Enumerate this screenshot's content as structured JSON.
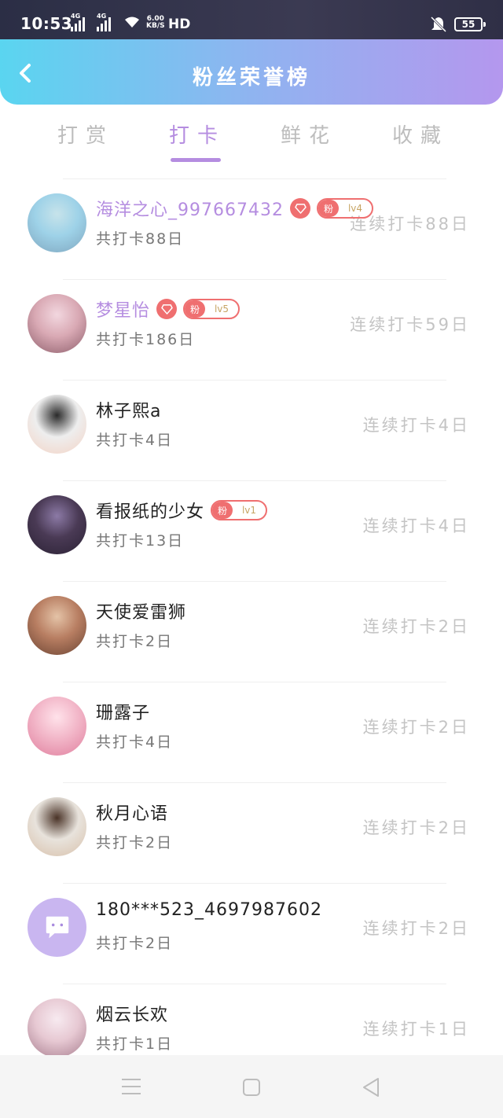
{
  "status_bar": {
    "time": "10:53",
    "network1": "4G",
    "network2": "4G",
    "speed_value": "6.00",
    "speed_unit": "KB/S",
    "hd": "HD",
    "battery": "55"
  },
  "header": {
    "title": "粉丝荣誉榜",
    "back_icon": "chevron-left-icon"
  },
  "tabs": [
    {
      "label": "打赏",
      "active": false
    },
    {
      "label": "打卡",
      "active": true
    },
    {
      "label": "鲜花",
      "active": false
    },
    {
      "label": "收藏",
      "active": false
    }
  ],
  "list": [
    {
      "name": "海洋之心_997667432",
      "vip": true,
      "gem": true,
      "fan_label": "粉",
      "level": "lv4",
      "total": "共打卡88日",
      "streak": "连续打卡88日",
      "avatar_colors": [
        "#9ed2e8",
        "#c7e3ea",
        "#7fa6bf"
      ]
    },
    {
      "name": "梦星怡",
      "vip": true,
      "gem": true,
      "fan_label": "粉",
      "level": "lv5",
      "total": "共打卡186日",
      "streak": "连续打卡59日",
      "avatar_colors": [
        "#d9a9b4",
        "#f2d7df",
        "#8e5f6c"
      ]
    },
    {
      "name": "林子熙a",
      "vip": false,
      "gem": false,
      "fan_label": "",
      "level": "",
      "total": "共打卡4日",
      "streak": "连续打卡4日",
      "avatar_colors": [
        "#eeeeee",
        "#2a2a2a",
        "#f3d3c5"
      ]
    },
    {
      "name": "看报纸的少女",
      "vip": false,
      "gem": false,
      "fan_label": "粉",
      "level": "lv1",
      "total": "共打卡13日",
      "streak": "连续打卡4日",
      "avatar_colors": [
        "#4a3a55",
        "#8c7aa6",
        "#2b2235"
      ]
    },
    {
      "name": "天使爱雷狮",
      "vip": false,
      "gem": false,
      "fan_label": "",
      "level": "",
      "total": "共打卡2日",
      "streak": "连续打卡2日",
      "avatar_colors": [
        "#b87e62",
        "#e4c3a7",
        "#6b4433"
      ]
    },
    {
      "name": "珊露子",
      "vip": false,
      "gem": false,
      "fan_label": "",
      "level": "",
      "total": "共打卡4日",
      "streak": "连续打卡2日",
      "avatar_colors": [
        "#f2b6c8",
        "#ffe2ea",
        "#e07f9e"
      ]
    },
    {
      "name": "秋月心语",
      "vip": false,
      "gem": false,
      "fan_label": "",
      "level": "",
      "total": "共打卡2日",
      "streak": "连续打卡2日",
      "avatar_colors": [
        "#e8e3dc",
        "#4a3327",
        "#d8c0aa"
      ]
    },
    {
      "name": "180***523_4697987602",
      "vip": false,
      "gem": false,
      "fan_label": "",
      "level": "",
      "total": "共打卡2日",
      "streak": "连续打卡2日",
      "avatar_colors": [
        "#c9b6f0",
        "#ffffff",
        "#a98bdf"
      ],
      "default_avatar": true
    },
    {
      "name": "烟云长欢",
      "vip": false,
      "gem": false,
      "fan_label": "",
      "level": "",
      "total": "共打卡1日",
      "streak": "连续打卡1日",
      "avatar_colors": [
        "#e7c9d3",
        "#f7eaf0",
        "#a77d8e"
      ]
    }
  ],
  "nav_bar": {
    "menu_icon": "menu-icon",
    "home_icon": "home-square-icon",
    "back_icon": "back-triangle-icon"
  },
  "colors": {
    "accent": "#b58de0",
    "badge_red": "#ef6f70",
    "header_gradient_start": "#5ad5f0",
    "header_gradient_end": "#b497ee"
  }
}
